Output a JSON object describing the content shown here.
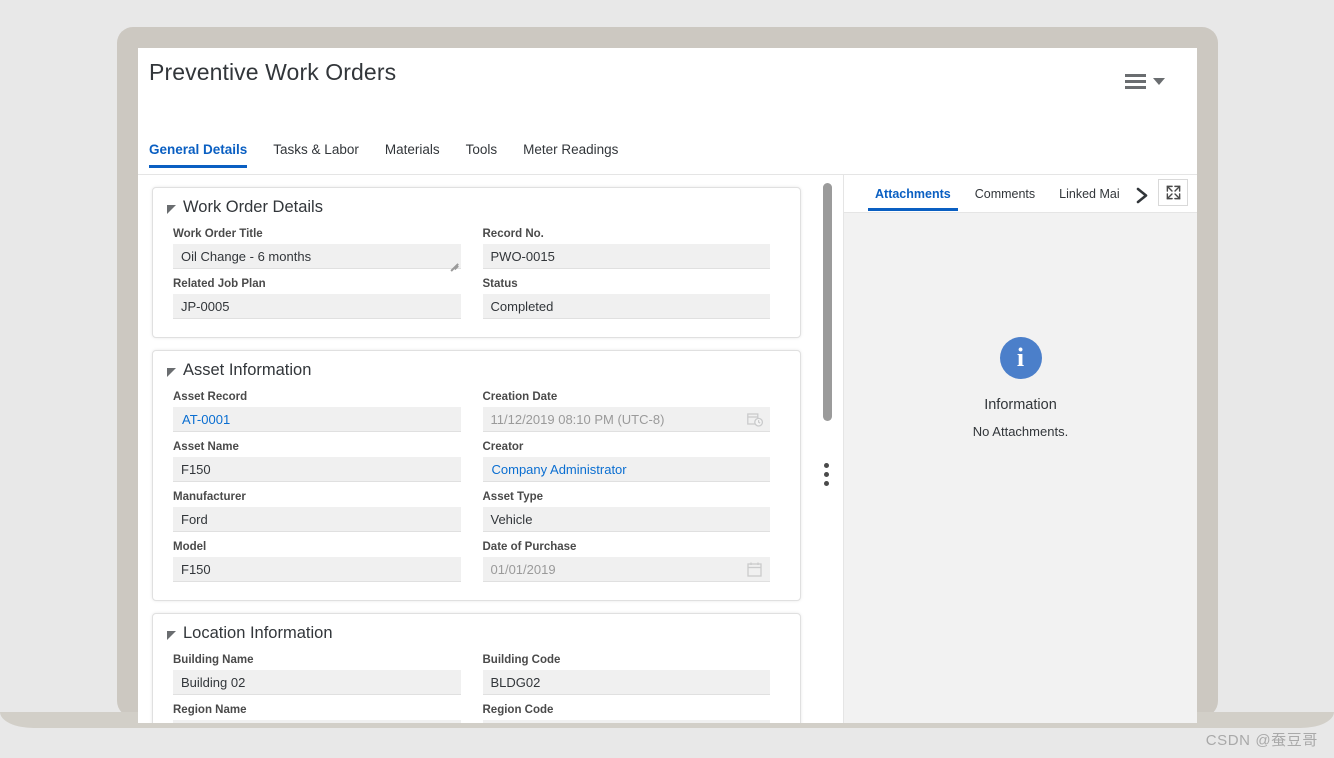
{
  "header": {
    "title": "Preventive Work Orders",
    "menu_icon": "hamburger-menu-icon",
    "caret_icon": "chevron-down-icon"
  },
  "main_tabs": [
    {
      "label": "General Details",
      "active": true
    },
    {
      "label": "Tasks & Labor",
      "active": false
    },
    {
      "label": "Materials",
      "active": false
    },
    {
      "label": "Tools",
      "active": false
    },
    {
      "label": "Meter Readings",
      "active": false
    }
  ],
  "sections": [
    {
      "title": "Work Order Details",
      "fields": [
        {
          "label": "Work Order Title",
          "value": "Oil Change - 6 months",
          "style": "textarea"
        },
        {
          "label": "Record No.",
          "value": "PWO-0015",
          "style": "plain"
        },
        {
          "label": "Related Job Plan",
          "value": "JP-0005",
          "style": "plain"
        },
        {
          "label": "Status",
          "value": "Completed",
          "style": "plain"
        }
      ]
    },
    {
      "title": "Asset Information",
      "fields": [
        {
          "label": "Asset Record",
          "value": "AT-0001",
          "style": "link"
        },
        {
          "label": "Creation Date",
          "value": "11/12/2019 08:10 PM  (UTC-8)",
          "style": "datetime"
        },
        {
          "label": "Asset Name",
          "value": "F150",
          "style": "plain"
        },
        {
          "label": "Creator",
          "value": "Company Administrator",
          "style": "link"
        },
        {
          "label": "Manufacturer",
          "value": "Ford",
          "style": "plain"
        },
        {
          "label": "Asset Type",
          "value": "Vehicle",
          "style": "plain"
        },
        {
          "label": "Model",
          "value": "F150",
          "style": "plain"
        },
        {
          "label": "Date of Purchase",
          "value": "01/01/2019",
          "style": "date"
        }
      ]
    },
    {
      "title": "Location Information",
      "fields": [
        {
          "label": "Building Name",
          "value": "Building 02",
          "style": "plain"
        },
        {
          "label": "Building Code",
          "value": "BLDG02",
          "style": "plain"
        },
        {
          "label": "Region Name",
          "value": "",
          "style": "plain"
        },
        {
          "label": "Region Code",
          "value": "",
          "style": "plain"
        }
      ]
    }
  ],
  "side_panel": {
    "tabs": [
      {
        "label": "Attachments",
        "active": true
      },
      {
        "label": "Comments",
        "active": false
      },
      {
        "label": "Linked Mai",
        "active": false
      }
    ],
    "more_icon": "chevron-right-icon",
    "expand_icon": "expand-fullscreen-icon",
    "message": {
      "icon": "information-icon",
      "glyph": "i",
      "title": "Information",
      "text": "No Attachments."
    }
  },
  "splitter": {
    "scrollbar_icon": "vertical-scrollbar",
    "handle_icon": "three-dots-drag-handle"
  },
  "watermark": "CSDN @蚕豆哥",
  "colors": {
    "accent": "#0a5fc2",
    "link": "#0a6ed1",
    "info": "#4b7fca",
    "field_bg": "#f0f0f0",
    "panel_bg": "#f2f2f2",
    "bezel": "#ccc8c1",
    "page_bg": "#e8e8e8"
  }
}
